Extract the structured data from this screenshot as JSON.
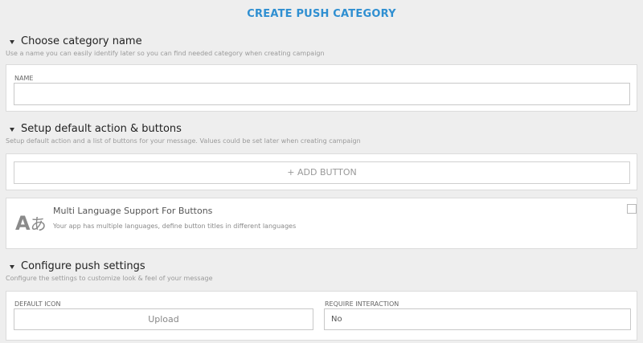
{
  "page_title": "CREATE PUSH CATEGORY",
  "sections": {
    "category_name": {
      "title": "Choose category name",
      "description": "Use a name you can easily identify later so you can find needed category when creating campaign",
      "name_label": "NAME",
      "name_value": "",
      "name_placeholder": ""
    },
    "actions": {
      "title": "Setup default action & buttons",
      "description": "Setup default action and a list of buttons for your message. Values could be set later when creating campaign",
      "add_button_label": "+ ADD BUTTON",
      "multi_language": {
        "icon": "translate-icon",
        "icon_latin": "A",
        "icon_kana": "あ",
        "title": "Multi Language Support For Buttons",
        "description": "Your app has multiple languages, define button titles in different languages",
        "checked": false
      }
    },
    "push_settings": {
      "title": "Configure push settings",
      "description": "Configure the settings to customize look & feel of your message",
      "default_icon_label": "DEFAULT ICON",
      "upload_label": "Upload",
      "require_interaction_label": "REQUIRE INTERACTION",
      "require_interaction_value": "No"
    }
  },
  "colors": {
    "accent": "#2f8fd1",
    "background": "#eeeeee",
    "card": "#ffffff"
  }
}
